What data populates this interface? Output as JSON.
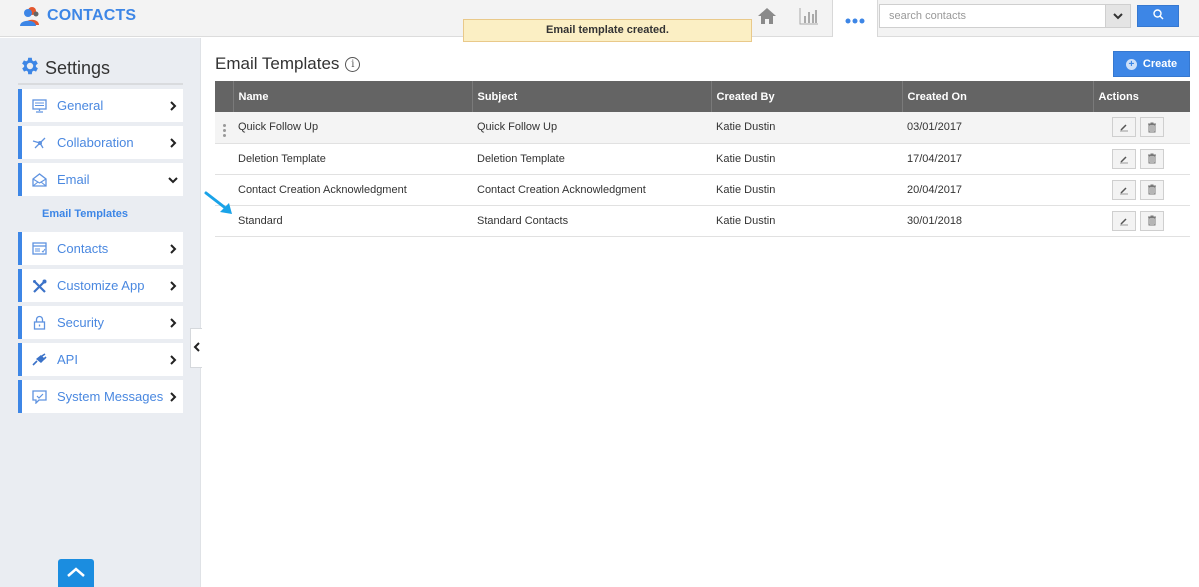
{
  "app": {
    "title": "CONTACTS",
    "icon": "contacts-people-icon"
  },
  "toast": {
    "message": "Email template created."
  },
  "topnav": {
    "icons": [
      "home-icon",
      "reports-bar-chart-icon",
      "more-dots-icon"
    ],
    "search_placeholder": "search contacts",
    "search_value": "",
    "search_button_icon": "search-icon",
    "dropdown_icon": "chevron-down-icon"
  },
  "sidebar": {
    "title": "Settings",
    "title_icon": "gear-icon",
    "items": [
      {
        "label": "General",
        "icon": "monitor-icon",
        "state": "collapsed"
      },
      {
        "label": "Collaboration",
        "icon": "network-icon",
        "state": "collapsed"
      },
      {
        "label": "Email",
        "icon": "envelope-icon",
        "state": "expanded"
      },
      {
        "label": "Contacts",
        "icon": "contact-card-icon",
        "state": "collapsed"
      },
      {
        "label": "Customize App",
        "icon": "tools-icon",
        "state": "collapsed"
      },
      {
        "label": "Security",
        "icon": "lock-icon",
        "state": "collapsed"
      },
      {
        "label": "API",
        "icon": "plug-icon",
        "state": "collapsed"
      },
      {
        "label": "System Messages",
        "icon": "message-icon",
        "state": "collapsed"
      }
    ],
    "email_submenu": [
      {
        "label": "Email Templates",
        "active": true
      }
    ]
  },
  "main": {
    "title": "Email Templates",
    "create_label": "Create",
    "table": {
      "columns": [
        "Name",
        "Subject",
        "Created By",
        "Created On",
        "Actions"
      ],
      "rows": [
        {
          "name": "Quick Follow Up",
          "subject": "Quick Follow Up",
          "created_by": "Katie Dustin",
          "created_on": "03/01/2017"
        },
        {
          "name": "Deletion Template",
          "subject": "Deletion Template",
          "created_by": "Katie Dustin",
          "created_on": "17/04/2017"
        },
        {
          "name": "Contact Creation Acknowledgment",
          "subject": "Contact Creation Acknowledgment",
          "created_by": "Katie Dustin",
          "created_on": "20/04/2017"
        },
        {
          "name": "Standard",
          "subject": "Standard Contacts",
          "created_by": "Katie Dustin",
          "created_on": "30/01/2018"
        }
      ]
    }
  },
  "colors": {
    "accent": "#3d86e6",
    "header_bg": "#646464",
    "toast_bg": "#fbefc4",
    "annotation_arrow": "#1aa3e8"
  }
}
